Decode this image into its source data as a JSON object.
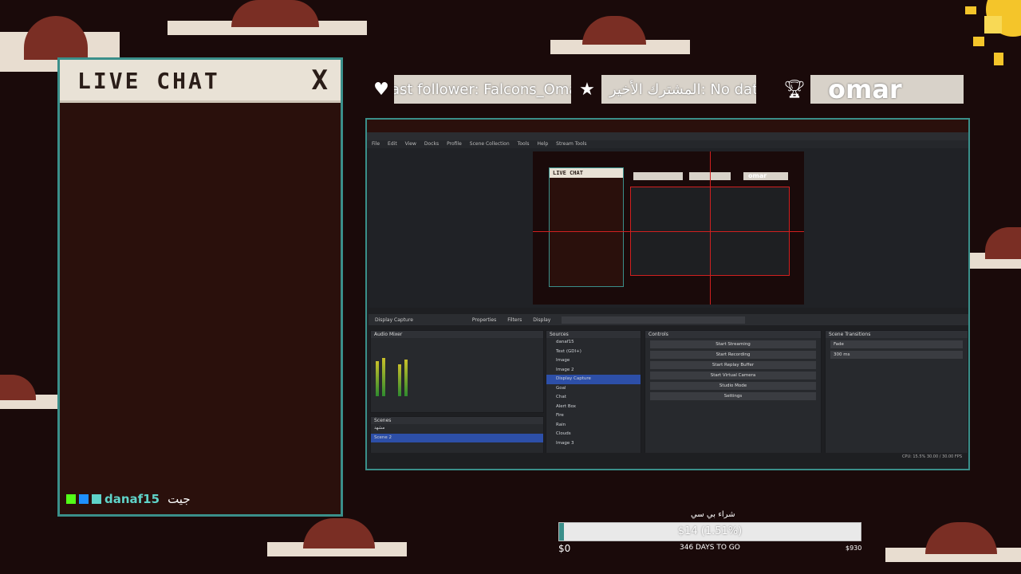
{
  "chat": {
    "title": "LIVE CHAT",
    "close_label": "X",
    "message": {
      "user": "danaf15",
      "text": "جيت"
    }
  },
  "stats": {
    "last_follower": "Last follower: Falcons_Omar",
    "last_subscriber": "المشترك الأخير: No data",
    "top_name": "omar",
    "icons": [
      "heart-icon",
      "star-icon",
      "trophy-icon"
    ]
  },
  "obs": {
    "menu": [
      "File",
      "Edit",
      "View",
      "Docks",
      "Profile",
      "Scene Collection",
      "Tools",
      "Help",
      "Stream Tools"
    ],
    "mini_chat_title": "LIVE CHAT",
    "mini_top_name": "omar",
    "toolbar": [
      "Display Capture",
      "Properties",
      "Filters",
      "Display"
    ],
    "panels": {
      "audio_mixer": "Audio Mixer",
      "scenes": "Scenes",
      "sources": "Sources",
      "controls": "Controls",
      "transitions": "Scene Transitions"
    },
    "scenes": [
      "مشهد",
      "Scene 2"
    ],
    "sources": [
      "danaf15",
      "Text (GDI+)",
      "Image",
      "Image 2",
      "Display Capture",
      "Goal",
      "Chat",
      "Alert Box",
      "Fire",
      "Rain",
      "Clouds",
      "Image 3"
    ],
    "selected_source": "Display Capture",
    "controls": [
      "Start Streaming",
      "Start Recording",
      "Start Replay Buffer",
      "Start Virtual Camera",
      "Studio Mode",
      "Settings"
    ],
    "transition": {
      "type": "Fade",
      "duration": "300 ms"
    },
    "status": "CPU: 15.5%   30.00 / 30.00 FPS"
  },
  "goal": {
    "title": "شراء بي سي",
    "progress_text": "$14 (1.51%)",
    "progress_fraction": 0.0151,
    "min": "$0",
    "days": "346 DAYS TO GO",
    "max": "$930"
  },
  "colors": {
    "accent": "#3a8f8a",
    "panel_bg": "#2a100c",
    "page_bg": "#1a0a0a",
    "cloud": "#e8ddd0",
    "cloud_dark": "#7a2e24",
    "select": "#2d4fa8"
  }
}
